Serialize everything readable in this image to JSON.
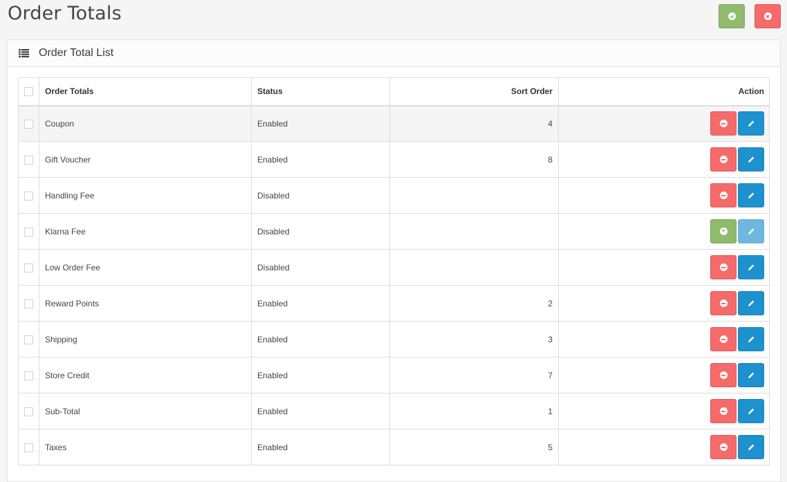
{
  "header": {
    "title": "Order Totals",
    "save_icon": "check-circle-icon",
    "cancel_icon": "times-circle-icon",
    "colors": {
      "save": "#8fbb6c",
      "cancel": "#f56b6b"
    }
  },
  "panel": {
    "icon": "list-icon",
    "title": "Order Total List"
  },
  "table": {
    "columns": [
      "Order Totals",
      "Status",
      "Sort Order",
      "Action"
    ],
    "rows": [
      {
        "name": "Coupon",
        "status": "Enabled",
        "sort_order": "4",
        "installed": true,
        "hover": true
      },
      {
        "name": "Gift Voucher",
        "status": "Enabled",
        "sort_order": "8",
        "installed": true
      },
      {
        "name": "Handling Fee",
        "status": "Disabled",
        "sort_order": "",
        "installed": true
      },
      {
        "name": "Klarna Fee",
        "status": "Disabled",
        "sort_order": "",
        "installed": false
      },
      {
        "name": "Low Order Fee",
        "status": "Disabled",
        "sort_order": "",
        "installed": true
      },
      {
        "name": "Reward Points",
        "status": "Enabled",
        "sort_order": "2",
        "installed": true
      },
      {
        "name": "Shipping",
        "status": "Enabled",
        "sort_order": "3",
        "installed": true
      },
      {
        "name": "Store Credit",
        "status": "Enabled",
        "sort_order": "7",
        "installed": true
      },
      {
        "name": "Sub-Total",
        "status": "Enabled",
        "sort_order": "1",
        "installed": true
      },
      {
        "name": "Taxes",
        "status": "Enabled",
        "sort_order": "5",
        "installed": true
      }
    ],
    "action_icons": {
      "uninstall": "minus-circle-icon",
      "install": "plus-circle-icon",
      "edit": "pencil-icon"
    },
    "colors": {
      "uninstall": "#f56b6b",
      "install": "#8fbb6c",
      "edit": "#1e91cf",
      "edit_disabled": "#6fb7e0"
    }
  }
}
